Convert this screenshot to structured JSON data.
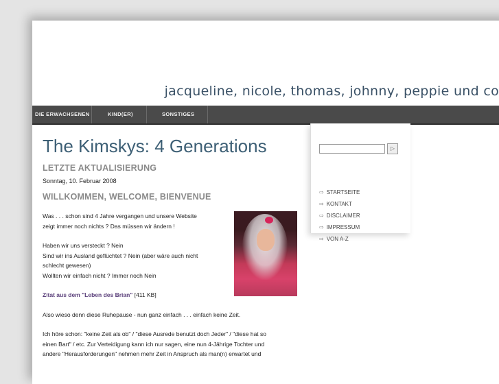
{
  "header": {
    "tagline": "jacqueline, nicole, thomas, johnny, peppie und co."
  },
  "nav": {
    "items": [
      "DIE ERWACHSENEN",
      "KIND(ER)",
      "SONSTIGES"
    ]
  },
  "main": {
    "title": "The Kimskys: 4 Generations",
    "update_heading": "LETZTE AKTUALISIERUNG",
    "update_date": "Sonntag, 10. Februar 2008",
    "welcome_heading": "WILLKOMMEN, WELCOME, BIENVENUE",
    "p1_l1": "Was . . . schon sind 4 Jahre vergangen und unsere Website",
    "p1_l2": "zeigt immer noch nichts ? Das müssen wir ändern !",
    "p2_l1": "Haben wir uns versteckt ? Nein",
    "p2_l2": "Sind wir ins Ausland geflüchtet ? Nein (aber wäre auch nicht",
    "p2_l3": "schlecht gewesen)",
    "p2_l4": "Wollten wir einfach nicht ? Immer noch Nein",
    "quote_link": "Zitat aus dem \"Leben des Brian\"",
    "quote_size": "[411 KB]",
    "p3": "Also wieso denn diese Ruhepause - nun ganz einfach . . . einfach keine Zeit.",
    "p4_l1": "Ich höre schon: \"keine Zeit als ob\" / \"diese Ausrede benutzt doch Jeder\" / \"diese hat so",
    "p4_l2": "einen Bart\" / etc. Zur Verteidigung kann ich nur sagen, eine nun 4-Jährige Tochter und",
    "p4_l3": "andere \"Herausforderungen\" nehmen mehr Zeit in Anspruch als man(n) erwartet und"
  },
  "sidebar": {
    "search_value": "",
    "search_button_icon": "arrow-right-icon",
    "items": [
      "STARTSEITE",
      "KONTAKT",
      "DISCLAIMER",
      "IMPRESSUM",
      "VON A-Z"
    ]
  }
}
